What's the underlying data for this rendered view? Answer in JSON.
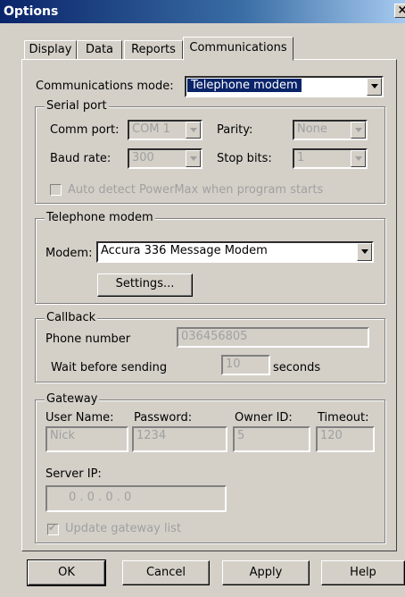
{
  "window": {
    "title": "Options",
    "close_label": "×"
  },
  "tabs": [
    {
      "label": "Display",
      "active": false
    },
    {
      "label": "Data",
      "active": false
    },
    {
      "label": "Reports",
      "active": false
    },
    {
      "label": "Communications",
      "active": true
    }
  ],
  "communications_mode": {
    "label": "Communications mode:",
    "value": "Telephone modem"
  },
  "serial_port": {
    "title": "Serial port",
    "comm_port_label": "Comm port:",
    "comm_port_value": "COM 1",
    "parity_label": "Parity:",
    "parity_value": "None",
    "baud_rate_label": "Baud rate:",
    "baud_rate_value": "300",
    "stop_bits_label": "Stop bits:",
    "stop_bits_value": "1",
    "auto_detect_label": "Auto detect PowerMax when program starts",
    "auto_detect_checked": false
  },
  "telephone_modem": {
    "title": "Telephone modem",
    "modem_label": "Modem:",
    "modem_value": "Accura 336 Message Modem",
    "settings_label": "Settings..."
  },
  "callback": {
    "title": "Callback",
    "phone_label": "Phone number",
    "phone_value": "036456805",
    "wait_label": "Wait before sending",
    "wait_value": "10",
    "wait_unit": "seconds"
  },
  "gateway": {
    "title": "Gateway",
    "user_label": "User Name:",
    "user_value": "Nick",
    "password_label": "Password:",
    "password_value": "1234",
    "owner_label": "Owner ID:",
    "owner_value": "5",
    "timeout_label": "Timeout:",
    "timeout_value": "120",
    "server_ip_label": "Server IP:",
    "server_ip_value": "0  .  0  .  0  .  0",
    "update_label": "Update gateway list",
    "update_checked": true
  },
  "buttons": {
    "ok": "OK",
    "cancel": "Cancel",
    "apply": "Apply",
    "help": "Help"
  },
  "colors": {
    "titlebar": "#0a246a",
    "face": "#d4d0c8",
    "selection": "#0a246a"
  }
}
